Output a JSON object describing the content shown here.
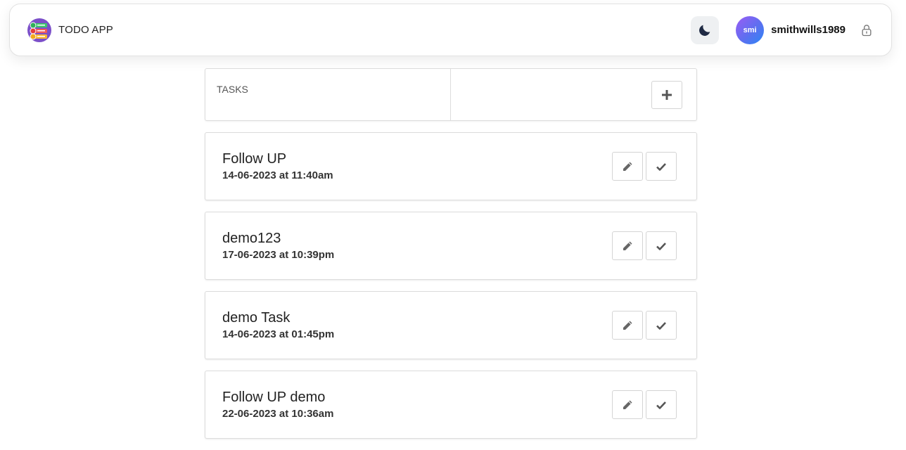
{
  "header": {
    "app_title": "TODO APP",
    "username": "smithwills1989",
    "avatar_initials": "smi",
    "theme_icon": "moon-icon",
    "lock_icon": "lock-icon"
  },
  "tasks_panel": {
    "label": "TASKS",
    "add_icon": "plus-icon"
  },
  "tasks": [
    {
      "title": "Follow UP",
      "date": "14-06-2023 at 11:40am"
    },
    {
      "title": "demo123",
      "date": "17-06-2023 at 10:39pm"
    },
    {
      "title": "demo Task",
      "date": "14-06-2023 at 01:45pm"
    },
    {
      "title": "Follow UP demo",
      "date": "22-06-2023 at 10:36am"
    }
  ],
  "colors": {
    "avatar_gradient_start": "#9b5cf5",
    "avatar_gradient_end": "#2b86f5",
    "moon": "#1f2a44",
    "icon_gray": "#666666"
  }
}
